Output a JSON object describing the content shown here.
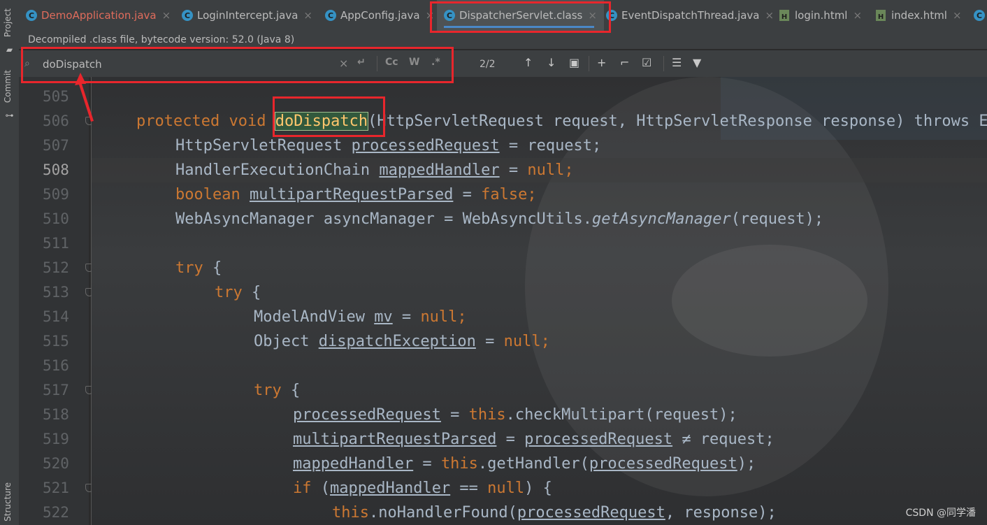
{
  "tool_strip": {
    "project_label": "Project",
    "commit_label": "Commit",
    "structure_label": "Structure"
  },
  "tabs": [
    {
      "label": "DemoApplication.java",
      "icon": "class-icon",
      "state": "error"
    },
    {
      "label": "LoginIntercept.java",
      "icon": "class-icon",
      "state": "normal"
    },
    {
      "label": "AppConfig.java",
      "icon": "class-icon",
      "state": "normal"
    },
    {
      "label": "DispatcherServlet.class",
      "icon": "class-icon",
      "state": "active"
    },
    {
      "label": "EventDispatchThread.java",
      "icon": "class-icon",
      "state": "normal"
    },
    {
      "label": "login.html",
      "icon": "html-icon",
      "state": "normal"
    },
    {
      "label": "index.html",
      "icon": "html-icon",
      "state": "normal"
    }
  ],
  "info_bar": "Decompiled .class file, bytecode version: 52.0 (Java 8)",
  "search": {
    "value": "doDispatch",
    "match_case_label": "Cc",
    "words_label": "W",
    "regex_label": ".*",
    "match_count": "2/2"
  },
  "code_lines": [
    {
      "number": "505"
    },
    {
      "number": "506"
    },
    {
      "number": "507"
    },
    {
      "number": "508"
    },
    {
      "number": "509"
    },
    {
      "number": "510"
    },
    {
      "number": "511"
    },
    {
      "number": "512"
    },
    {
      "number": "513"
    },
    {
      "number": "514"
    },
    {
      "number": "515"
    },
    {
      "number": "516"
    },
    {
      "number": "517"
    },
    {
      "number": "518"
    },
    {
      "number": "519"
    },
    {
      "number": "520"
    },
    {
      "number": "521"
    },
    {
      "number": "522"
    }
  ],
  "code": {
    "l506": {
      "protected": "protected",
      "void": "void",
      "method": "doDispatch",
      "rest": "(HttpServletRequest request, HttpServletResponse response) throws Exception {"
    },
    "l507": {
      "type": "HttpServletRequest",
      "var": "processedRequest",
      "rest": " = request;"
    },
    "l508": {
      "type": "HandlerExecutionChain",
      "var": "mappedHandler",
      "eq": " = ",
      "val": "null",
      "end": ";"
    },
    "l509": {
      "type": "boolean",
      "var": "multipartRequestParsed",
      "eq": " = ",
      "val": "false",
      "end": ";"
    },
    "l510": {
      "a": "WebAsyncManager asyncManager = WebAsyncUtils.",
      "b": "getAsyncManager",
      "c": "(request);"
    },
    "l512": {
      "kw": "try",
      "rest": " {"
    },
    "l513": {
      "kw": "try",
      "rest": " {"
    },
    "l514": {
      "type": "ModelAndView ",
      "var": "mv",
      "eq": " = ",
      "val": "null",
      "end": ";"
    },
    "l515": {
      "type": "Object ",
      "var": "dispatchException",
      "eq": " = ",
      "val": "null",
      "end": ";"
    },
    "l517": {
      "kw": "try",
      "rest": " {"
    },
    "l518": {
      "var": "processedRequest",
      "eq": " = ",
      "this": "this",
      "rest": ".checkMultipart(request);"
    },
    "l519": {
      "var": "multipartRequestParsed",
      "eq": " = ",
      "var2": "processedRequest",
      "rest": " ≠ request;"
    },
    "l520": {
      "var": "mappedHandler",
      "eq": " = ",
      "this": "this",
      "rest": ".getHandler(",
      "var2": "processedRequest",
      "end": ");"
    },
    "l521": {
      "kw": "if",
      "a": " (",
      "var": "mappedHandler",
      "b": " == ",
      "val": "null",
      "c": ") {"
    },
    "l522": {
      "this": "this",
      "a": ".noHandlerFound(",
      "var": "processedRequest",
      "b": ", response);"
    }
  },
  "watermark": "CSDN @同学潘"
}
